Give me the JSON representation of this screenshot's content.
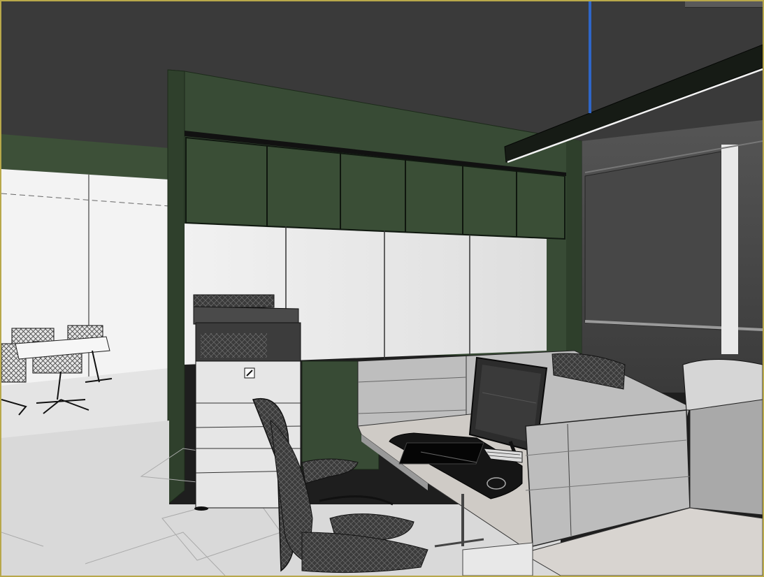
{
  "viewport": {
    "active_border_color": "#b8a84a",
    "render_mode": "shaded-with-edges",
    "view_type": "perspective",
    "axis_color": "#2f66c8"
  },
  "scene": {
    "palette": {
      "ceiling": "#3a3a3a",
      "feature_wall_green": "#374b34",
      "glass": "#ececec",
      "floor": "#dcdcdc",
      "partition": "#bdbdbd",
      "desk": "#cfcbc6",
      "dark_glass": "#474747"
    },
    "objects": [
      "ceiling",
      "green-feature-wall",
      "overhead-cabinets",
      "glass-partition",
      "meeting-room",
      "copier",
      "workstation-desk",
      "desk-partition",
      "monitor",
      "keyboard",
      "desk-mat",
      "office-chair",
      "linear-pendant-light",
      "blue-axis-gizmo"
    ]
  }
}
